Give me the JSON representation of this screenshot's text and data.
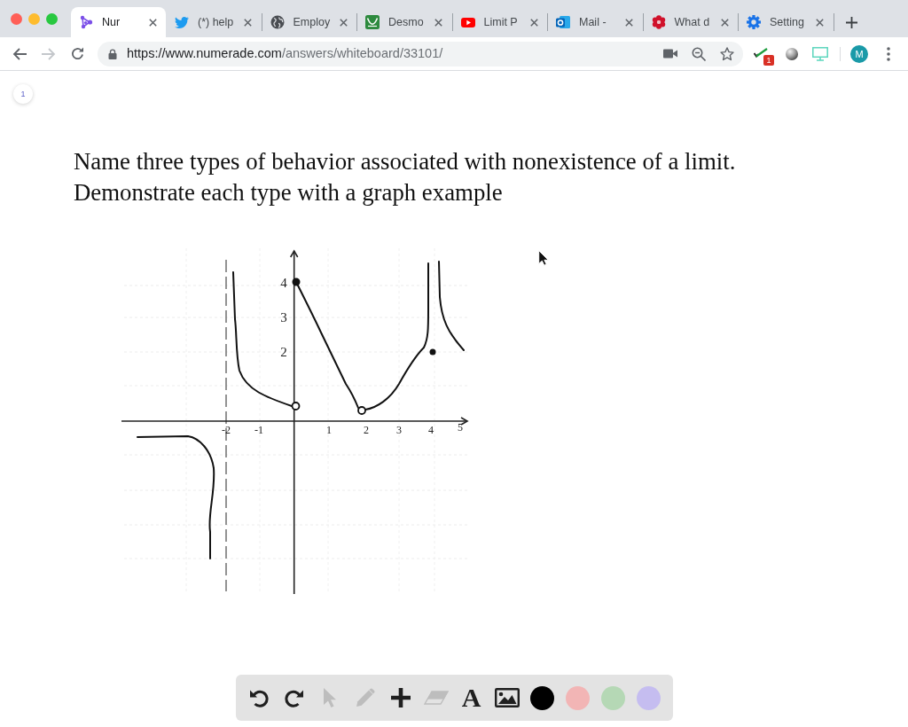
{
  "tabs": [
    {
      "title": "Nur",
      "selected": true
    },
    {
      "title": "(*) help",
      "selected": false
    },
    {
      "title": "Employ",
      "selected": false
    },
    {
      "title": "Desmo",
      "selected": false
    },
    {
      "title": "Limit P",
      "selected": false
    },
    {
      "title": "Mail -",
      "selected": false
    },
    {
      "title": "What d",
      "selected": false
    },
    {
      "title": "Setting",
      "selected": false
    }
  ],
  "toolbar": {
    "back_disabled": false,
    "forward_disabled": true,
    "url_host": "https://www.numerade.com",
    "url_path": "/answers/whiteboard/33101/",
    "extension_badge": "1",
    "avatar": "M"
  },
  "page": {
    "page_number": "1",
    "question": [
      "Name three types of behavior associated with nonexistence of a limit.",
      "Demonstrate each type with a graph example"
    ]
  },
  "graph": {
    "y_labels": [
      "4",
      "3",
      "2"
    ],
    "x_labels": [
      "-2",
      "-1",
      "1",
      "2",
      "3",
      "4",
      "5"
    ]
  },
  "drawing_tools": [
    {
      "kind": "undo",
      "disabled": false
    },
    {
      "kind": "redo",
      "disabled": false
    },
    {
      "kind": "select",
      "disabled": true
    },
    {
      "kind": "pencil",
      "disabled": true
    },
    {
      "kind": "add",
      "disabled": false
    },
    {
      "kind": "eraser",
      "disabled": true
    },
    {
      "kind": "text",
      "label": "A",
      "disabled": false
    },
    {
      "kind": "image",
      "disabled": false
    }
  ],
  "colors": [
    {
      "color": "#000000"
    },
    {
      "color": "#f2b5b5"
    },
    {
      "color": "#b5d8b5"
    },
    {
      "color": "#c5bdf0"
    }
  ]
}
